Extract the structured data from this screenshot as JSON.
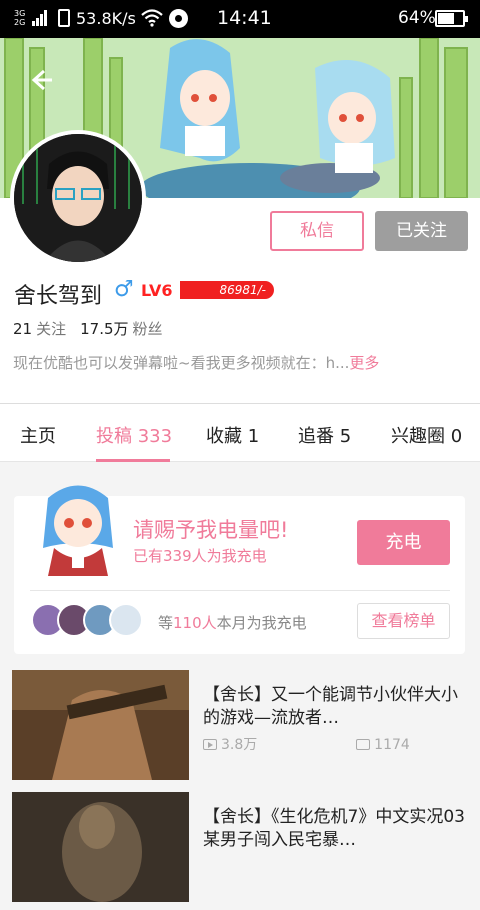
{
  "status": {
    "network": "3G\n2G",
    "speed": "53.8K/s",
    "time": "14:41",
    "battery": "64%"
  },
  "profile": {
    "name": "舍长驾到",
    "gender": "♂",
    "level": "LV6",
    "exp": "86981/-",
    "following_count": "21",
    "following_label": "关注",
    "fans_count": "17.5万",
    "fans_label": "粉丝",
    "bio": "现在优酷也可以发弹幕啦~看我更多视频就在：h...",
    "bio_more": "更多",
    "message_btn": "私信",
    "follow_btn": "已关注"
  },
  "tabs": [
    {
      "label": "主页"
    },
    {
      "label": "投稿 333"
    },
    {
      "label": "收藏 1"
    },
    {
      "label": "追番 5"
    },
    {
      "label": "兴趣圈 0"
    }
  ],
  "charge": {
    "title": "请赐予我电量吧!",
    "subtitle": "已有339人为我充电",
    "button": "充电",
    "month_prefix": "等",
    "month_count": "110人",
    "month_suffix": "本月为我充电",
    "rank_button": "查看榜单"
  },
  "videos": [
    {
      "title": "【舍长】又一个能调节小伙伴大小的游戏—流放者…",
      "plays": "3.8万",
      "danmaku": "1174"
    },
    {
      "title": "【舍长】《生化危机7》中文实况03 某男子闯入民宅暴…",
      "plays": "",
      "danmaku": ""
    }
  ],
  "colors": {
    "accent": "#f07b9a",
    "level": "#f02020",
    "followed": "#9e9e9e"
  }
}
